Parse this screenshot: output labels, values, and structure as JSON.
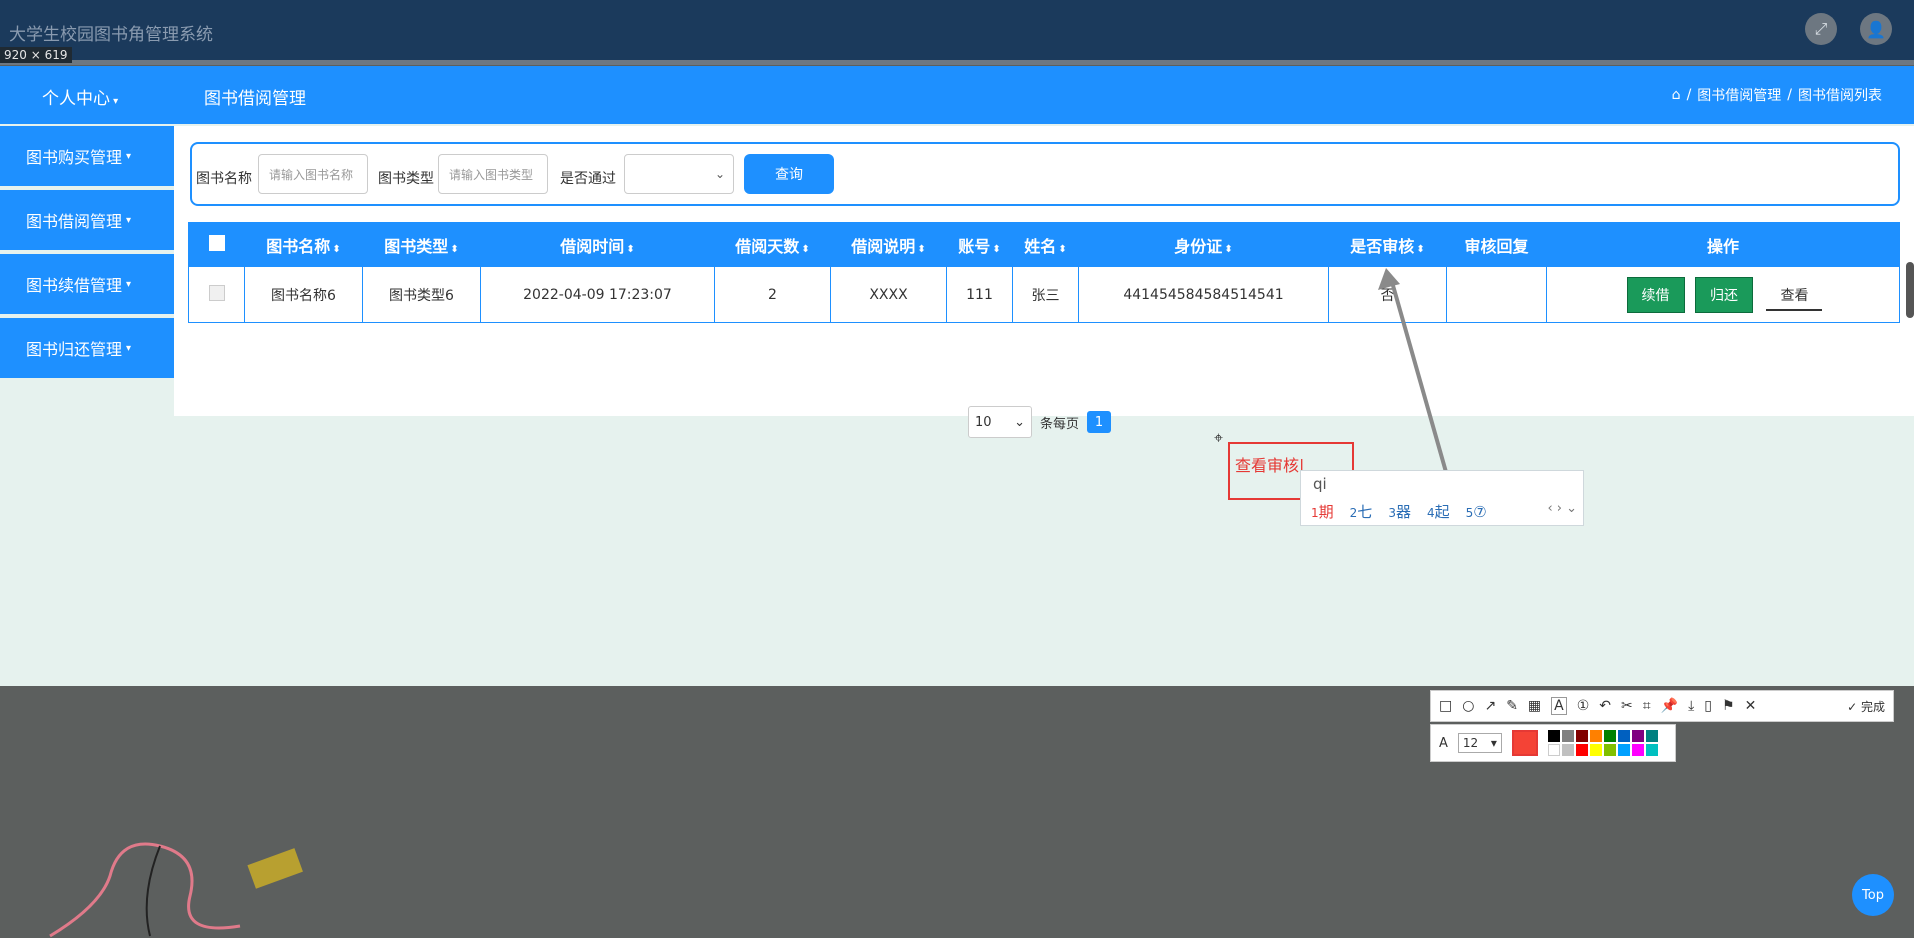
{
  "window": {
    "title": "大学生校园图书角管理系统",
    "size_label": "920 × 619"
  },
  "header": {
    "center_label": "个人中心",
    "section_title": "图书借阅管理",
    "breadcrumb": [
      "图书借阅管理",
      "图书借阅列表"
    ]
  },
  "sidebar": {
    "items": [
      {
        "label": "图书购买管理"
      },
      {
        "label": "图书借阅管理"
      },
      {
        "label": "图书续借管理"
      },
      {
        "label": "图书归还管理"
      }
    ]
  },
  "search": {
    "book_name_label": "图书名称",
    "book_name_placeholder": "请输入图书名称",
    "book_type_label": "图书类型",
    "book_type_placeholder": "请输入图书类型",
    "approved_label": "是否通过",
    "approved_value": "",
    "query_button": "查询"
  },
  "table": {
    "headers": [
      "图书名称",
      "图书类型",
      "借阅时间",
      "借阅天数",
      "借阅说明",
      "账号",
      "姓名",
      "身份证",
      "是否审核",
      "审核回复",
      "操作"
    ],
    "rows": [
      {
        "book_name": "图书名称6",
        "book_type": "图书类型6",
        "borrow_time": "2022-04-09 17:23:07",
        "days": "2",
        "note": "XXXX",
        "account": "111",
        "name": "张三",
        "id_card": "441454584584514541",
        "reviewed": "否",
        "reply": "",
        "actions": {
          "renew": "续借",
          "return": "归还",
          "view": "查看"
        }
      }
    ]
  },
  "pagination": {
    "page_size": "10",
    "per_page_label": "条每页",
    "current_page": "1"
  },
  "annotation": {
    "text": "查看审核",
    "ime_input": "qi",
    "candidates": [
      {
        "index": "1",
        "char": "期"
      },
      {
        "index": "2",
        "char": "七"
      },
      {
        "index": "3",
        "char": "器"
      },
      {
        "index": "4",
        "char": "起"
      },
      {
        "index": "5",
        "char": "⑦"
      }
    ]
  },
  "tools": {
    "done_label": "完成",
    "font_size": "12",
    "active_color": "#f44336",
    "palette": [
      "#000000",
      "#808080",
      "#800000",
      "#ff8000",
      "#008000",
      "#0060c0",
      "#800080",
      "#008080",
      "#ffffff",
      "#c0c0c0",
      "#ff0000",
      "#ffff00",
      "#80c000",
      "#00a0ff",
      "#ff00ff",
      "#00c0c0"
    ]
  },
  "top_button": "Top"
}
